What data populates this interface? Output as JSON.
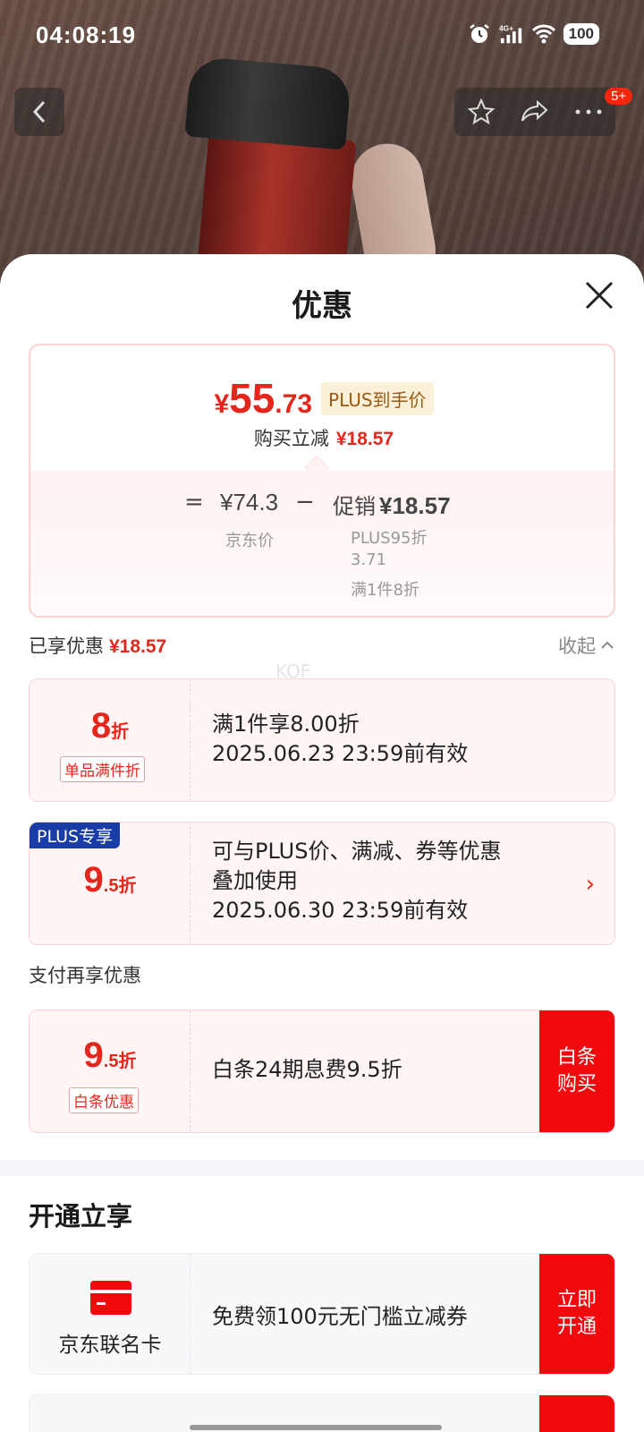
{
  "status_bar": {
    "time": "04:08:19",
    "network": "4G+",
    "battery": "100"
  },
  "nav": {
    "badge": "5+"
  },
  "sheet": {
    "title": "优惠"
  },
  "summary": {
    "price_currency": "¥",
    "price_int": "55",
    "price_dec": ".73",
    "price_tag": "PLUS到手价",
    "reduce_label": "购买立减",
    "reduce_amount": "¥18.57",
    "eq_sign": "=",
    "jd_price": "¥74.3",
    "minus_sign": "−",
    "promo_label": "促销",
    "promo_amount": "¥18.57",
    "jd_price_label": "京东价",
    "promo_line1": "PLUS95折",
    "promo_line2": "3.71",
    "promo_line3": "满1件8折"
  },
  "enjoyed": {
    "label": "已享优惠",
    "amount": "¥18.57",
    "collapse": "收起"
  },
  "watermark": "KOF",
  "coupons": [
    {
      "big": "8",
      "small": "折",
      "tag": "单品满件折",
      "line1": "满1件享8.00折",
      "line2": "2025.06.23 23:59前有效"
    },
    {
      "corner": "PLUS专享",
      "big": "9",
      "small": ".5折",
      "line1": "可与PLUS价、满减、券等优惠",
      "line2": "叠加使用",
      "line3": "2025.06.30 23:59前有效",
      "chevron": "›"
    }
  ],
  "pay": {
    "header": "支付再享优惠",
    "big": "9",
    "small": ".5折",
    "tag": "白条优惠",
    "text": "白条24期息费9.5折",
    "cta_line1": "白条",
    "cta_line2": "购买"
  },
  "open": {
    "header": "开通立享",
    "card_label": "京东联名卡",
    "text": "免费领100元无门槛立减券",
    "cta_line1": "立即",
    "cta_line2": "开通"
  },
  "colors": {
    "accent": "#e4271d",
    "cta": "#f2090d",
    "plus_blue": "#1a3ca6"
  }
}
